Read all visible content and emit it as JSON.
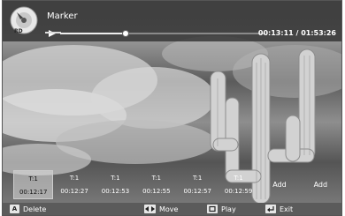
{
  "header": {
    "title": "Marker",
    "time": "00:13:11 / 01:53:26",
    "progress": 0.32
  },
  "markers": [
    {
      "title": "T:1",
      "time": "00:12:17",
      "selected": true
    },
    {
      "title": "T:1",
      "time": "00:12:27"
    },
    {
      "title": "T:1",
      "time": "00:12:53"
    },
    {
      "title": "T:1",
      "time": "00:12:55"
    },
    {
      "title": "T:1",
      "time": "00:12:57"
    },
    {
      "title": "T:1",
      "time": "00:12:59"
    }
  ],
  "add_slots": [
    "Add",
    "Add"
  ],
  "footer": {
    "delete_key": "A",
    "delete_label": "Delete",
    "move_label": "Move",
    "play_label": "Play",
    "exit_label": "Exit"
  }
}
